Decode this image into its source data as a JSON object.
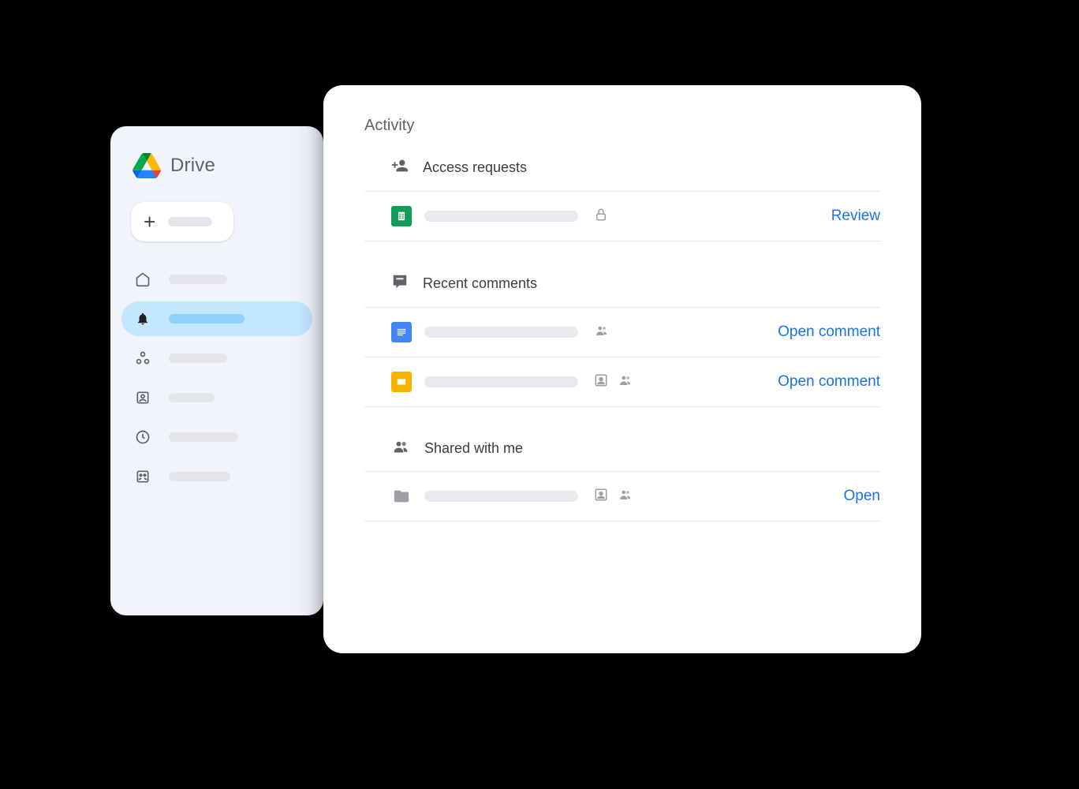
{
  "sidebar": {
    "title": "Drive"
  },
  "panel": {
    "title": "Activity",
    "sections": {
      "access_requests": {
        "title": "Access requests",
        "items": [
          {
            "action": "Review"
          }
        ]
      },
      "recent_comments": {
        "title": "Recent comments",
        "items": [
          {
            "action": "Open comment"
          },
          {
            "action": "Open comment"
          }
        ]
      },
      "shared_with_me": {
        "title": "Shared with me",
        "items": [
          {
            "action": "Open"
          }
        ]
      }
    }
  }
}
